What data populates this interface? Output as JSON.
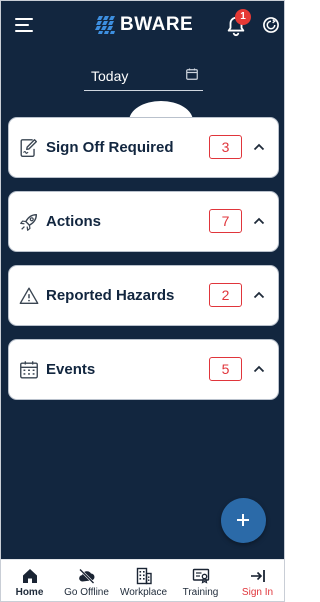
{
  "header": {
    "brand": "BWARE",
    "notification_count": "1",
    "date_value": "Today"
  },
  "cards": [
    {
      "label": "Sign Off Required",
      "count": "3",
      "icon": "sign-off-icon"
    },
    {
      "label": "Actions",
      "count": "7",
      "icon": "rocket-icon"
    },
    {
      "label": "Reported Hazards",
      "count": "2",
      "icon": "warning-icon"
    },
    {
      "label": "Events",
      "count": "5",
      "icon": "calendar-icon"
    }
  ],
  "fab": {
    "icon": "plus-icon"
  },
  "bottom_nav": [
    {
      "label": "Home",
      "icon": "home-icon",
      "active": true
    },
    {
      "label": "Go Offline",
      "icon": "cloud-off-icon"
    },
    {
      "label": "Workplace",
      "icon": "building-icon"
    },
    {
      "label": "Training",
      "icon": "certificate-icon"
    },
    {
      "label": "Sign In",
      "icon": "sign-in-icon"
    }
  ],
  "colors": {
    "header_bg": "#12263f",
    "accent_red": "#e0353b",
    "fab_blue": "#2b6aa8",
    "badge_red": "#e53935"
  }
}
